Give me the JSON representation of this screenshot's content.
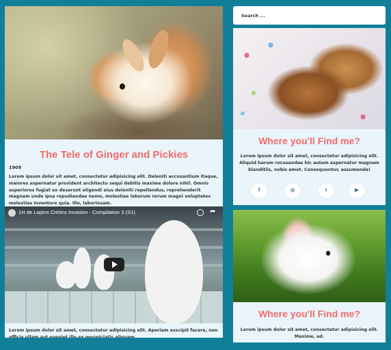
{
  "search": {
    "placeholder": "Search ..."
  },
  "left": {
    "title": "The Tele of Ginger and Pickies",
    "year": "1909",
    "paragraph1": "Lorem ipsum dolor sit amet, consectetur adipisicing elit. Deleniti accusantium itaque, maiores aspernatur provident architecto sequi debitis maxime dolore nihil. Omnis asperiores fugiat ex deserunt eligendi eius deleniti repellendus, reprehenderit magnam unde ipsa repudiandae nemo, molestiae laborum rerum magni voluptates molestias inventore quia. Illo, laboriosam.",
    "video": {
      "title": "1H de Lapins Crétins Invasion - Compilation 3 (S1)"
    },
    "paragraph2": "Lorem ipsum dolor sit amet, consectetur adipisicing elit. Aperiam suscipit facere, non officia ullam aut eveniet illo ex perspiciatis aliquam."
  },
  "right": {
    "card1": {
      "title": "Where you'll Find me?",
      "text": "Lorem ipsum dolor sit amet, consectetur adipisicing elit. Aliquid harum recusandae hic autem aspernatur magnam blanditiis, nobis amet. Consequuntur, assumenda!",
      "social": [
        {
          "icon": "facebook-icon",
          "glyph": "f"
        },
        {
          "icon": "instagram-icon",
          "glyph": "◎"
        },
        {
          "icon": "twitter-icon",
          "glyph": "t"
        },
        {
          "icon": "youtube-icon",
          "glyph": "▶"
        }
      ]
    },
    "card2": {
      "title": "Where you'll Find me?",
      "text": "Lorem ipsum dolor sit amet, consectetur adipisicing elit. Maxime, ad."
    }
  },
  "colors": {
    "background": "#127f98",
    "card": "#eaf5fb",
    "heading": "#f06a6a"
  }
}
